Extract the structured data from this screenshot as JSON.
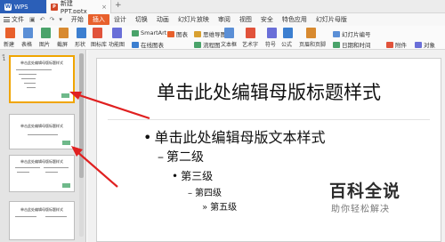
{
  "titlebar": {
    "app_tab": "WPS",
    "doc_tab": "新建PPT.pptx",
    "close_glyph": "×",
    "add_glyph": "+"
  },
  "menubar": {
    "file_label": "文件",
    "items": [
      "开始",
      "插入",
      "设计",
      "切换",
      "动画",
      "幻灯片放映",
      "审阅",
      "视图",
      "安全",
      "特色应用",
      "幻灯片母版"
    ],
    "active_index": 1
  },
  "ribbon": {
    "groups": {
      "new_slide": "新建",
      "table": "表格",
      "image": "图片",
      "screenshot": "截屏",
      "shape": "形状",
      "icon_lib": "图标库",
      "func_chart": "功能图",
      "smartart": "SmartArt",
      "chart": "图表",
      "mind_map": "思维导图",
      "flow_chart": "流程图",
      "online_image": "在线图表",
      "textbox": "文本框",
      "art_text": "艺术字",
      "symbol": "符号",
      "formula": "公式",
      "header_footer": "页眉和页脚",
      "slide_number": "幻灯片编号",
      "datetime": "日期和时间",
      "attachment": "附件",
      "object": "对象"
    }
  },
  "slide": {
    "title": "单击此处编辑母版标题样式",
    "bullets": [
      {
        "text": "单击此处编辑母版文本样式",
        "marker": "•"
      },
      {
        "text": "第二级",
        "marker": "–"
      },
      {
        "text": "第三级",
        "marker": "•"
      },
      {
        "text": "第四级",
        "marker": "–"
      },
      {
        "text": "第五级",
        "marker": "»"
      }
    ]
  },
  "thumbnails": {
    "title_text": "单击此处编辑母版标题样式",
    "collapse_glyph": "«",
    "first_number": "1"
  },
  "watermark": {
    "logo_text": "百科全说",
    "sub_text": "助你轻松解决"
  },
  "colors": {
    "accent": "#e8602c",
    "wps_blue": "#2b5fb8",
    "selection": "#f0a500",
    "arrow": "#e02020"
  }
}
